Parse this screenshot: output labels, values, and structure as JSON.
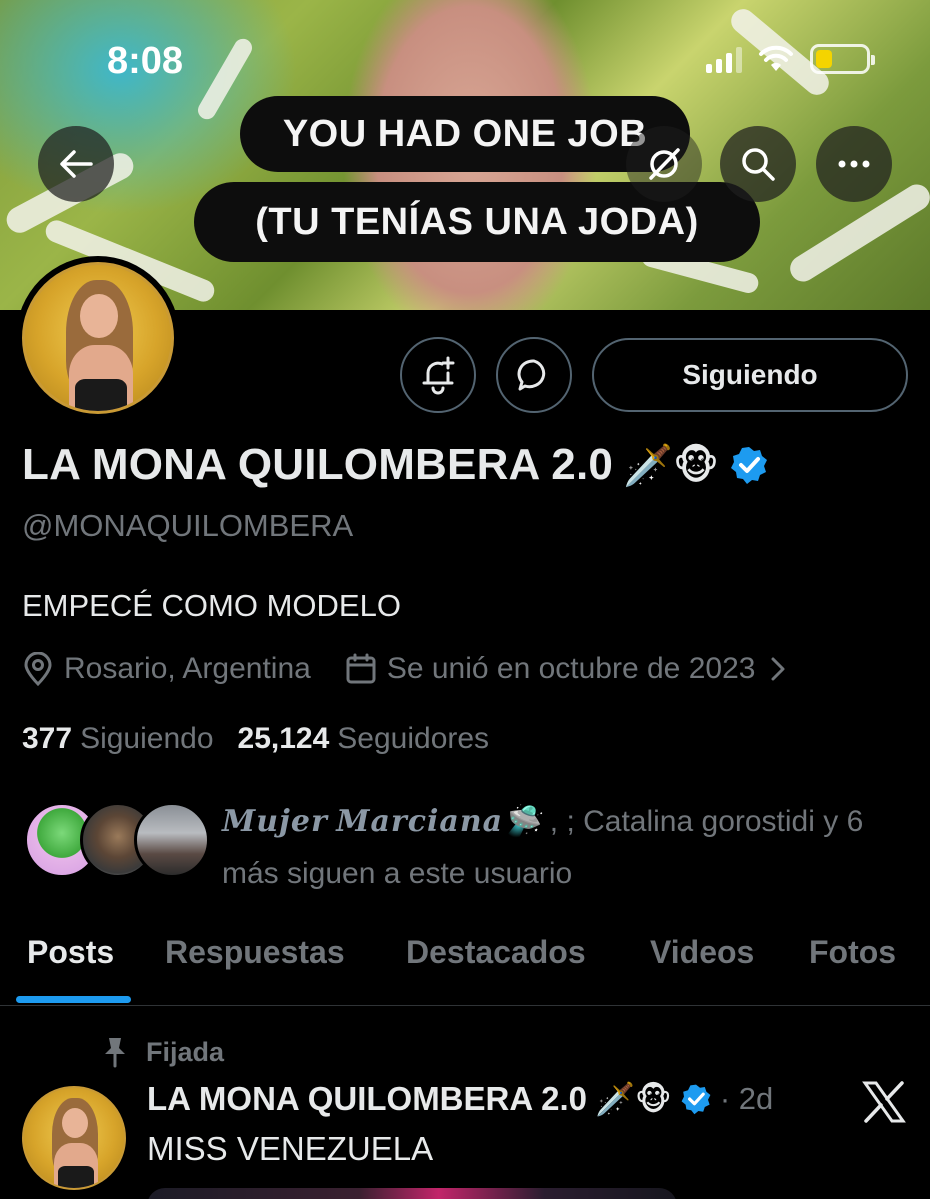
{
  "status_bar": {
    "time": "8:08"
  },
  "banner": {
    "caption_line1": "YOU HAD ONE JOB",
    "caption_line2": "(TU TENÍAS UNA JODA)"
  },
  "nav": {
    "back_icon": "arrow-left-icon",
    "grok_icon": "grok-icon",
    "search_icon": "search-icon",
    "more_icon": "more-icon"
  },
  "actions": {
    "follow_label": "Siguiendo"
  },
  "profile": {
    "display_name": "LA MONA QUILOMBERA 2.0",
    "name_emojis": "🗡️🐵",
    "handle": "@MONAQUILOMBERA",
    "bio": "EMPECÉ COMO MODELO",
    "location": "Rosario, Argentina",
    "joined": "Se unió en octubre de 2023",
    "following_count": "377",
    "following_label": "Siguiendo",
    "followers_count": "25,124",
    "followers_label": "Seguidores",
    "verified_color": "#1d9bf0"
  },
  "followed_by": {
    "name1": "𝑴𝒖𝒋𝒆𝒓 𝑴𝒂𝒓𝒄𝒊𝒂𝒏𝒂🛸",
    "rest": " , ; Catalina gorostidi y 6 más siguen a este usuario"
  },
  "tabs": [
    "Posts",
    "Respuestas",
    "Destacados",
    "Videos",
    "Fotos"
  ],
  "post": {
    "pinned_label": "Fijada",
    "author": "LA MONA QUILOMBERA 2.0",
    "author_emojis": "🗡️🐵",
    "time": "· 2d",
    "text": "MISS VENEZUELA"
  }
}
